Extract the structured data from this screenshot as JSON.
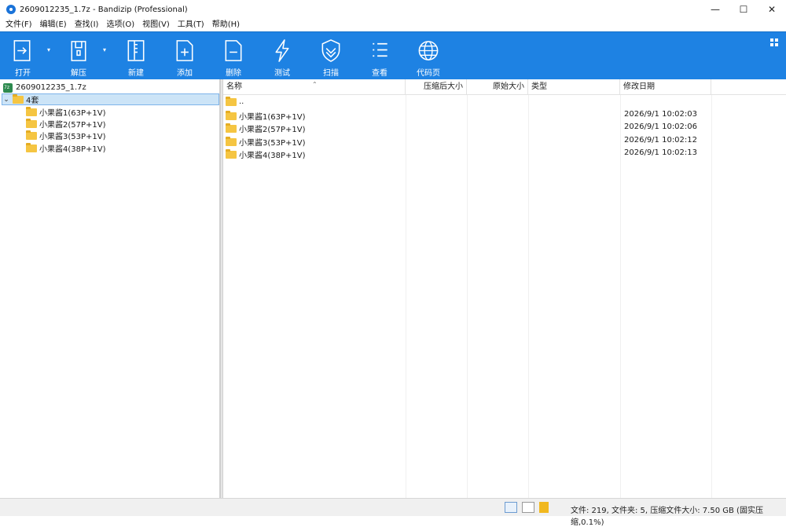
{
  "window": {
    "title": "2609012235_1.7z - Bandizip (Professional)"
  },
  "menu": [
    "文件(F)",
    "编辑(E)",
    "查找(I)",
    "选项(O)",
    "视图(V)",
    "工具(T)",
    "帮助(H)"
  ],
  "toolbar": {
    "open": "打开",
    "extract": "解压",
    "new": "新建",
    "add": "添加",
    "delete": "删除",
    "test": "测试",
    "scan": "扫描",
    "view": "查看",
    "codepage": "代码页"
  },
  "tree": {
    "root": "2609012235_1.7z",
    "folder": "4套",
    "children": [
      "小果酱1(63P+1V)",
      "小果酱2(57P+1V)",
      "小果酱3(53P+1V)",
      "小果酱4(38P+1V)"
    ]
  },
  "columns": {
    "name": "名称",
    "compressed": "压缩后大小",
    "original": "原始大小",
    "type": "类型",
    "modified": "修改日期"
  },
  "files": [
    {
      "name": "..",
      "date": ""
    },
    {
      "name": "小果酱1(63P+1V)",
      "date": "2026/9/1 10:02:03"
    },
    {
      "name": "小果酱2(57P+1V)",
      "date": "2026/9/1 10:02:06"
    },
    {
      "name": "小果酱3(53P+1V)",
      "date": "2026/9/1 10:02:12"
    },
    {
      "name": "小果酱4(38P+1V)",
      "date": "2026/9/1 10:02:13"
    }
  ],
  "status": {
    "text": "文件: 219, 文件夹: 5, 压缩文件大小: 7.50 GB (固实压缩,0.1%)"
  },
  "colors": {
    "toolbar": "#1e82e3",
    "folder": "#f5c542",
    "selection": "#cce4f7"
  }
}
